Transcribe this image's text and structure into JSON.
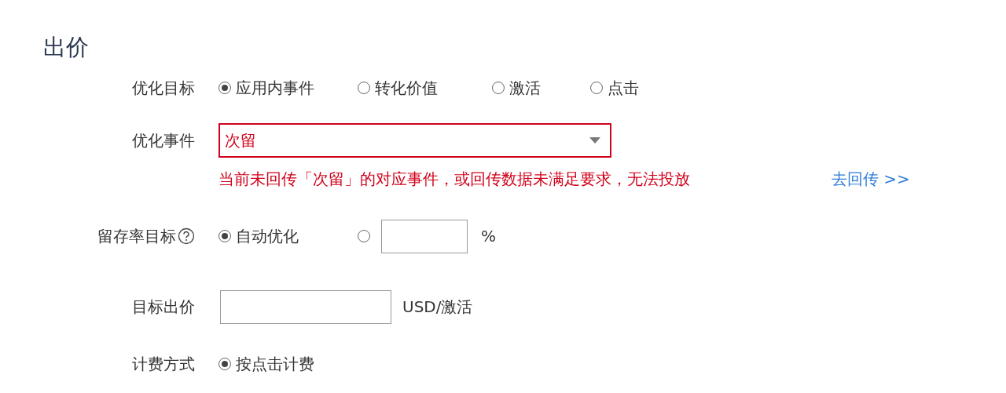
{
  "heading": "出价",
  "fields": [
    {
      "kind": "radio",
      "label": "优化目标",
      "options": [
        {
          "label": "应用内事件",
          "selected": true
        },
        {
          "label": "转化价值",
          "selected": false
        },
        {
          "label": "激活",
          "selected": false
        },
        {
          "label": "点击",
          "selected": false
        }
      ]
    },
    {
      "kind": "select",
      "label": "优化事件",
      "value": "次留",
      "invalid": true,
      "message": "当前未回传「次留」的对应事件，或回传数据未满足要求，无法投放",
      "link": "去回传 >>"
    },
    {
      "kind": "radio_input",
      "label": "留存率目标",
      "help": true,
      "options": [
        {
          "label": "自动优化",
          "selected": true
        },
        {
          "selected": false
        }
      ],
      "unit": "%"
    },
    {
      "kind": "input",
      "label": "目标出价",
      "unit": "USD/激活"
    },
    {
      "kind": "radio",
      "label": "计费方式",
      "options": [
        {
          "label": "按点击计费",
          "selected": true
        }
      ]
    }
  ]
}
